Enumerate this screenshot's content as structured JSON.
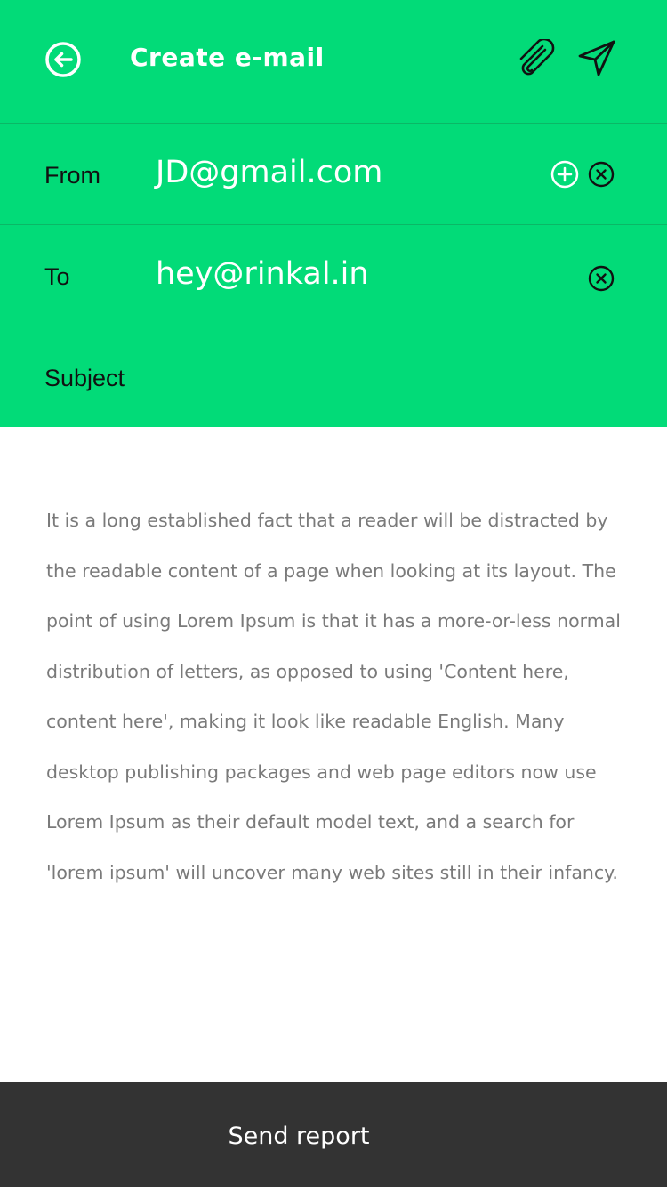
{
  "header": {
    "title": "Create e-mail",
    "back_icon": "arrow-left-circle-icon",
    "attach_icon": "paperclip-icon",
    "send_icon": "paper-plane-icon"
  },
  "fields": {
    "from": {
      "label": "From",
      "value": "JD@gmail.com",
      "icons": [
        "plus-circle-icon",
        "close-circle-icon"
      ]
    },
    "to": {
      "label": "To",
      "value": "hey@rinkal.in",
      "icons": [
        "close-circle-icon"
      ]
    },
    "subject": {
      "label": "Subject",
      "value": ""
    }
  },
  "body": {
    "text": "It is a long established fact that a reader will be distracted by the readable content of a page when looking at its layout. The point of using Lorem Ipsum is that it has a more-or-less normal distribution of letters, as opposed to using 'Content here, content here', making it look like readable English. Many desktop publishing packages and web page editors now use Lorem Ipsum as their default model text, and a search for 'lorem ipsum' will uncover many web sites still in their infancy."
  },
  "footer": {
    "send_label": "Send report"
  },
  "colors": {
    "accent": "#02db78",
    "footer": "#333333",
    "body_text": "#7a7a7a"
  }
}
